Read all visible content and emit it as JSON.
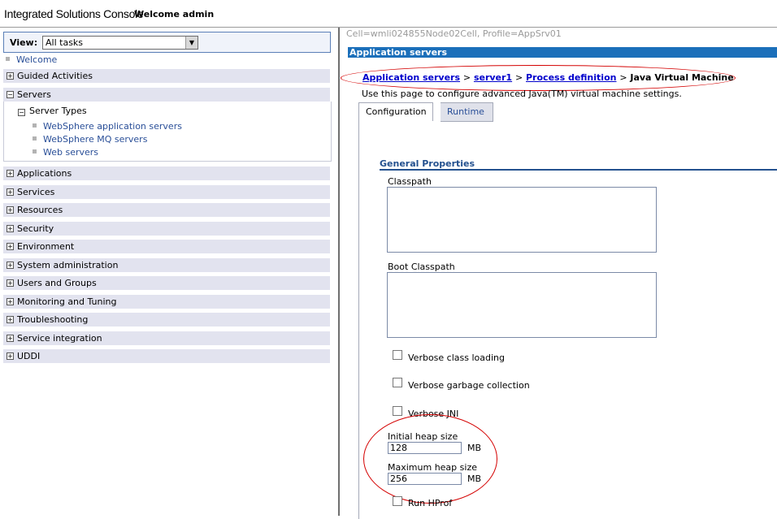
{
  "header": {
    "app_title": "Integrated Solutions Console",
    "welcome": "Welcome admin"
  },
  "nav": {
    "view_label": "View:",
    "view_value": "All tasks",
    "welcome_link": "Welcome",
    "categories": [
      {
        "label": "Guided Activities",
        "expanded": false
      },
      {
        "label": "Servers",
        "expanded": true
      },
      {
        "label": "Applications",
        "expanded": false
      },
      {
        "label": "Services",
        "expanded": false
      },
      {
        "label": "Resources",
        "expanded": false
      },
      {
        "label": "Security",
        "expanded": false
      },
      {
        "label": "Environment",
        "expanded": false
      },
      {
        "label": "System administration",
        "expanded": false
      },
      {
        "label": "Users and Groups",
        "expanded": false
      },
      {
        "label": "Monitoring and Tuning",
        "expanded": false
      },
      {
        "label": "Troubleshooting",
        "expanded": false
      },
      {
        "label": "Service integration",
        "expanded": false
      },
      {
        "label": "UDDI",
        "expanded": false
      }
    ],
    "server_types_label": "Server Types",
    "server_links": [
      "WebSphere application servers",
      "WebSphere MQ servers",
      "Web servers"
    ],
    "expand_glyph": "+",
    "collapse_glyph": "−"
  },
  "content": {
    "cell_info": "Cell=wmli024855Node02Cell, Profile=AppSrv01",
    "section_title": "Application servers",
    "breadcrumb": {
      "links": [
        "Application servers",
        "server1",
        "Process definition"
      ],
      "separator": ">",
      "current": "Java Virtual Machine"
    },
    "description": "Use this page to configure advanced Java(TM) virtual machine settings.",
    "tabs": [
      "Configuration",
      "Runtime"
    ],
    "general_properties": "General Properties",
    "classpath_label": "Classpath",
    "boot_classpath_label": "Boot Classpath",
    "checkboxes": [
      "Verbose class loading",
      "Verbose garbage collection",
      "Verbose JNI"
    ],
    "initial_heap_label": "Initial heap size",
    "initial_heap_value": "128",
    "max_heap_label": "Maximum heap size",
    "max_heap_value": "256",
    "unit": "MB",
    "run_hprof_label": "Run HProf"
  },
  "colors": {
    "section_bar": "#1b6fba",
    "link": "#2a4f98",
    "annotation": "#d40000"
  }
}
